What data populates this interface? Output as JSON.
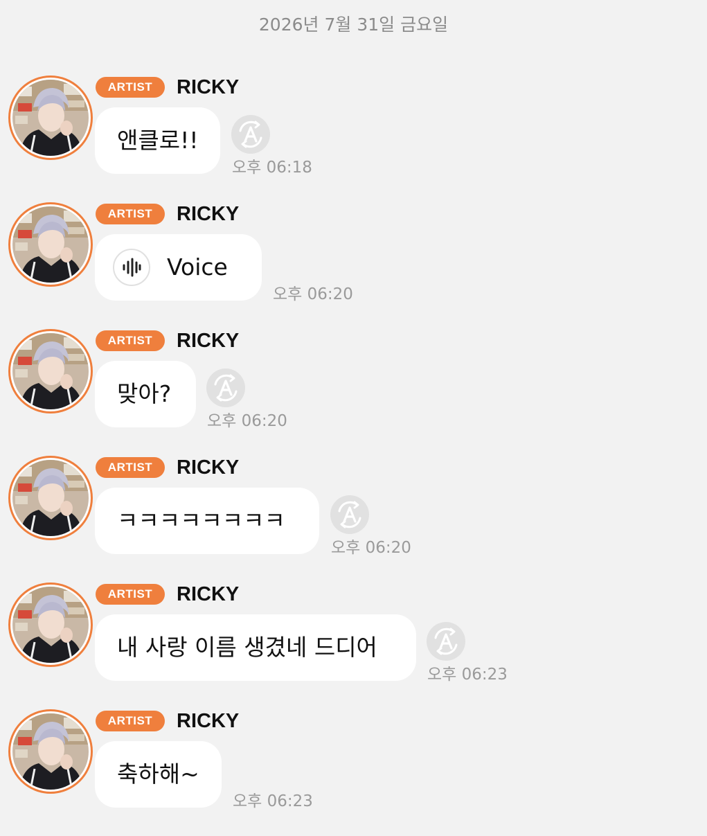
{
  "date_header": "2026년 7월 31일 금요일",
  "badge_label": "ARTIST",
  "accent_color": "#ef7f3d",
  "messages": [
    {
      "sender": "RICKY",
      "text": "앤클로!!",
      "time": "오후 06:18",
      "type": "text",
      "translate_icon": "translate-icon"
    },
    {
      "sender": "RICKY",
      "text": "Voice",
      "time": "오후 06:20",
      "type": "voice",
      "icon": "voice-waveform-icon"
    },
    {
      "sender": "RICKY",
      "text": "맞아?",
      "time": "오후 06:20",
      "type": "text",
      "translate_icon": "translate-icon"
    },
    {
      "sender": "RICKY",
      "text": "ㅋㅋㅋㅋㅋㅋㅋㅋ",
      "time": "오후 06:20",
      "type": "text",
      "translate_icon": "translate-icon"
    },
    {
      "sender": "RICKY",
      "text": "내 사랑 이름 생겼네 드디어",
      "time": "오후 06:23",
      "type": "text",
      "translate_icon": "translate-icon"
    },
    {
      "sender": "RICKY",
      "text": "축하해~",
      "time": "오후 06:23",
      "type": "text"
    }
  ]
}
